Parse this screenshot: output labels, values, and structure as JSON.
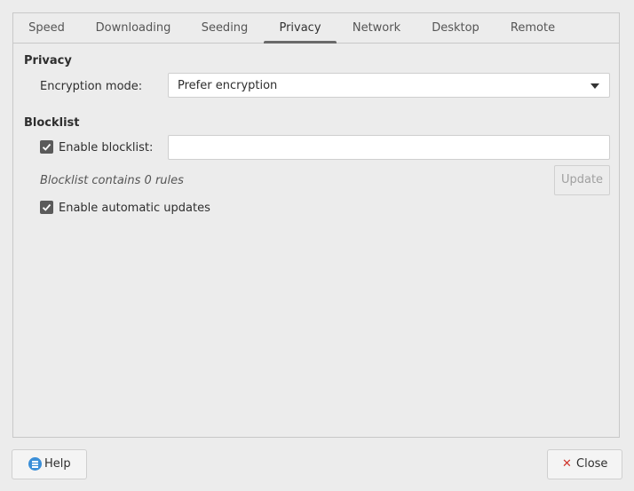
{
  "tabs": [
    {
      "label": "Speed"
    },
    {
      "label": "Downloading"
    },
    {
      "label": "Seeding"
    },
    {
      "label": "Privacy"
    },
    {
      "label": "Network"
    },
    {
      "label": "Desktop"
    },
    {
      "label": "Remote"
    }
  ],
  "active_tab": "Privacy",
  "privacy": {
    "section_title": "Privacy",
    "encryption_label": "Encryption mode:",
    "encryption_value": "Prefer encryption"
  },
  "blocklist": {
    "section_title": "Blocklist",
    "enable_label": "Enable blocklist:",
    "enable_checked": true,
    "url_value": "",
    "status_text": "Blocklist contains 0 rules",
    "update_label": "Update",
    "auto_update_label": "Enable automatic updates",
    "auto_update_checked": true
  },
  "footer": {
    "help_label": "Help",
    "close_label": "Close"
  },
  "colors": {
    "help_icon": "#3b8fd8",
    "close_icon": "#d0352b",
    "checkbox": "#5a5a5a"
  }
}
